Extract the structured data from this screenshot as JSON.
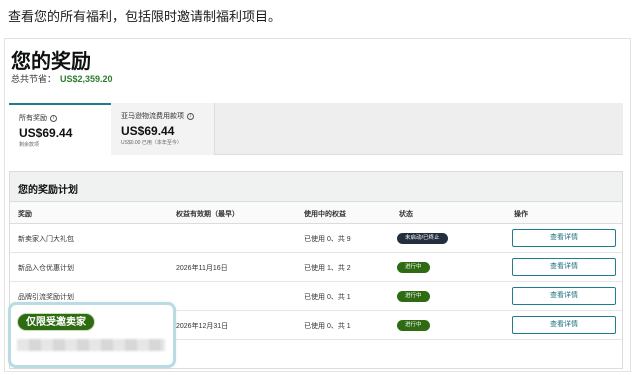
{
  "caption": "查看您的所有福利，包括限时邀请制福利项目。",
  "page": {
    "title": "您的奖励",
    "savings_label": "总共节省：",
    "savings_amount": "US$2,359.20"
  },
  "tabs": [
    {
      "label": "所有奖励",
      "amount": "US$69.44",
      "sub": "剩余款项"
    },
    {
      "label": "亚马逊物流费用款项",
      "amount": "US$69.44",
      "sub": "US$0.00 已用（本年至今）"
    }
  ],
  "plan": {
    "title": "您的奖励计划",
    "columns": [
      "奖励",
      "权益有效期（最早）",
      "使用中的权益",
      "状态",
      "操作"
    ],
    "rows": [
      {
        "name": "新卖家入门大礼包",
        "validity": "",
        "usage": "已使用 0、共 9",
        "status": "未启动/已终止",
        "status_color": "#232f3e",
        "action": "查看详情"
      },
      {
        "name": "新品入仓优惠计划",
        "validity": "2026年11月16日",
        "usage": "已使用 1、共 2",
        "status": "进行中",
        "status_color": "#2e6b12",
        "action": "查看详情"
      },
      {
        "name": "品牌引流奖励计划",
        "validity": "",
        "usage": "已使用 0、共 1",
        "status": "进行中",
        "status_color": "#2e6b12",
        "action": "查看详情"
      },
      {
        "name": "",
        "validity": "2026年12月31日",
        "usage": "已使用 0、共 1",
        "status": "进行中",
        "status_color": "#2e6b12",
        "action": "查看详情"
      }
    ]
  },
  "overlay": {
    "badge": "仅限受邀卖家"
  },
  "icons": {
    "info": "info-icon"
  },
  "colors": {
    "accent": "#1f7d8f",
    "green": "#2e6b12",
    "dark": "#232f3e",
    "savings": "#2e7d32"
  }
}
